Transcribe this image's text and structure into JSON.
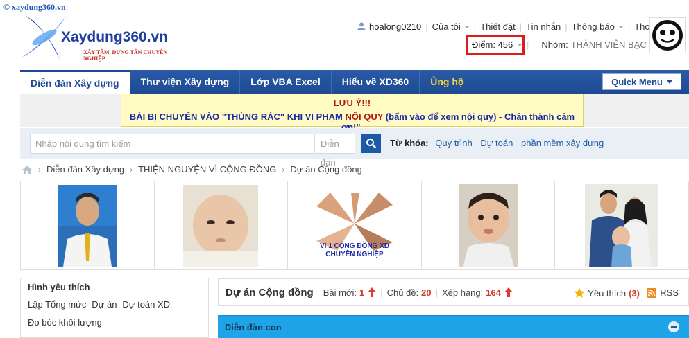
{
  "site": {
    "watermark": "© xaydung360.vn",
    "logo_text": "Xaydung360.vn",
    "logo_tagline": "XÂY TÂM, DỰNG TẦN CHUYÊN NGHIỆP"
  },
  "userbar": {
    "username": "hoalong0210",
    "menu": [
      "Của tôi",
      "Thiết đặt",
      "Tin nhắn",
      "Thông báo",
      "Thoát"
    ]
  },
  "points": {
    "label": "Điểm:",
    "value": "456"
  },
  "group": {
    "label": "Nhóm:",
    "value": "THÀNH VIÊN BẠC"
  },
  "nav": {
    "tabs": [
      "Diễn đàn Xây dựng",
      "Thư viện Xây dựng",
      "Lớp VBA Excel",
      "Hiểu về XD360",
      "Ủng hộ"
    ],
    "quick_menu": "Quick Menu"
  },
  "notice": {
    "title": "LƯU Ý!!!",
    "body_pre": "BÀI BỊ CHUYỂN VÀO \"THÙNG RÁC\" KHI VI PHẠM",
    "body_red": "NỘI QUY",
    "body_post": "(bấm vào để xem nội quy) - Chân thành cảm ơn!\"."
  },
  "search": {
    "placeholder": "Nhập nội dung tìm kiếm",
    "scope": "Diễn đàn",
    "keywords_label": "Từ khóa:",
    "keywords": [
      "Quy trình",
      "Dự toán",
      "phần mềm xây dựng"
    ]
  },
  "breadcrumb": [
    "Diễn đàn Xây dựng",
    "THIỆN NGUYỆN VÌ CỘNG ĐỒNG",
    "Dự án Cộng đồng"
  ],
  "banner": {
    "caption": "VÌ 1 CỘNG ĐỒNG XD CHUYÊN NGHIỆP"
  },
  "sidebar": {
    "title": "Hình yêu thích",
    "items": [
      "Lập Tổng mức- Dự án- Dự toán XD",
      "Đo bóc khối lượng"
    ]
  },
  "forum": {
    "name": "Dự án Cộng đồng",
    "new_posts_label": "Bài mới:",
    "new_posts": "1",
    "topics_label": "Chủ đề:",
    "topics": "20",
    "rank_label": "Xếp hạng:",
    "rank": "164",
    "favorite_label": "Yêu thích",
    "favorite_count": "(3)",
    "rss": "RSS"
  },
  "subforum": {
    "title": "Diễn đàn con"
  },
  "colors": {
    "nav_blue": "#1d4a92",
    "highlight_red": "#e01b1b",
    "subforum_blue": "#1fa4e8",
    "notice_yellow": "#fffbc2"
  }
}
